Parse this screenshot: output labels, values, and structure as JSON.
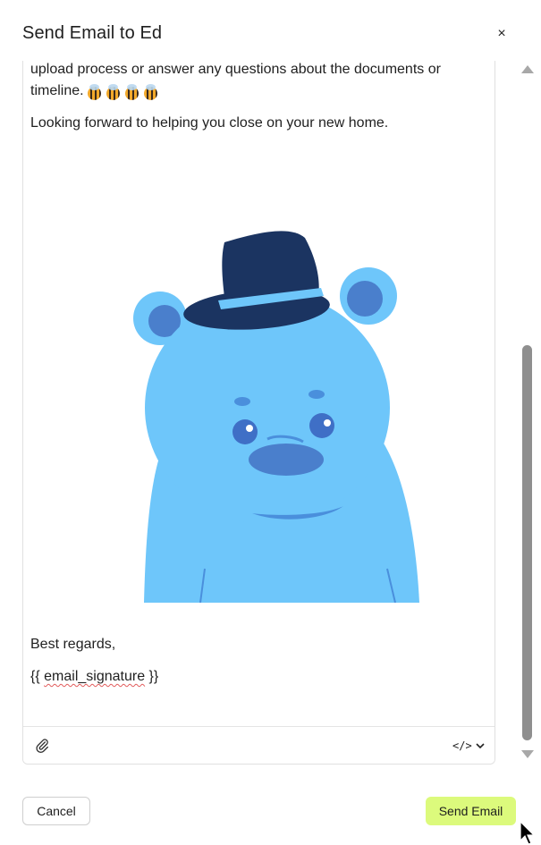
{
  "modal": {
    "title": "Send Email to Ed",
    "close_glyph": "×"
  },
  "email_body": {
    "paragraph_1": "upload process or answer any questions about the documents or timeline.",
    "paragraph_1_emoji": [
      "bee",
      "bee",
      "bee",
      "bee"
    ],
    "paragraph_2": "Looking forward to helping you close on your new home.",
    "image_icon": "blue-bear-with-fedora-illustration",
    "closing": "Best regards,",
    "signature_open": "{{ ",
    "signature_var": "email_signature",
    "signature_close": " }}"
  },
  "toolbar": {
    "attach_icon": "paperclip-icon",
    "code_icon": "code-icon",
    "code_glyph": "</>"
  },
  "footer": {
    "cancel_label": "Cancel",
    "send_label": "Send Email"
  },
  "colors": {
    "send_button": "#dcfa7c",
    "bear_body": "#6ec6fa",
    "bear_dark": "#4a7fcc",
    "hat": "#1b3461"
  }
}
